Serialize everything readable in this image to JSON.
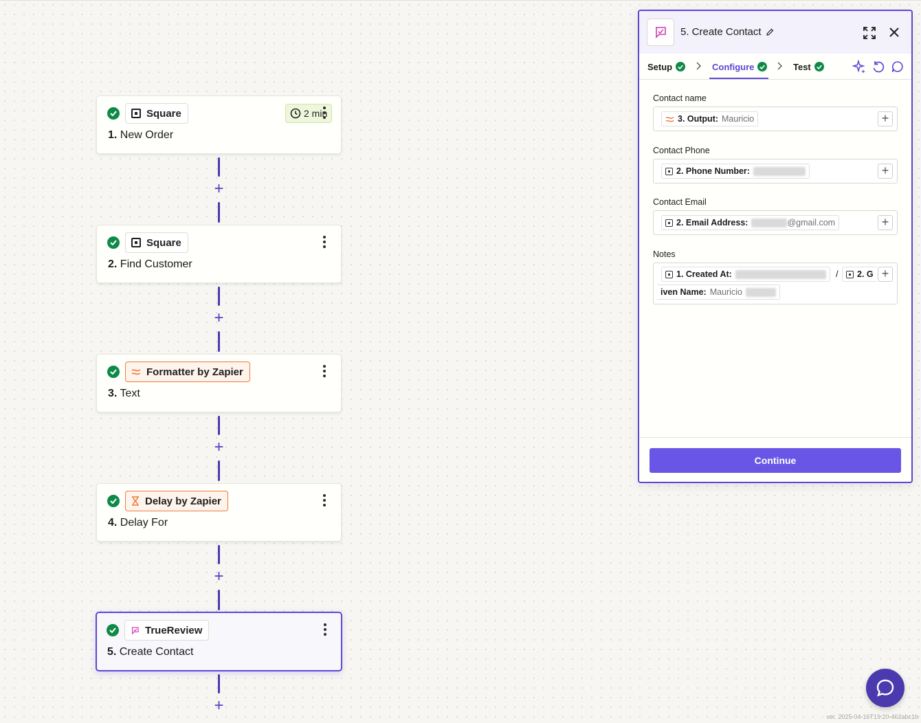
{
  "steps": [
    {
      "app": "Square",
      "number": "1.",
      "name": "New Order",
      "timer": "2 min"
    },
    {
      "app": "Square",
      "number": "2.",
      "name": "Find Customer"
    },
    {
      "app": "Formatter by Zapier",
      "number": "3.",
      "name": "Text"
    },
    {
      "app": "Delay by Zapier",
      "number": "4.",
      "name": "Delay For"
    },
    {
      "app": "TrueReview",
      "number": "5.",
      "name": "Create Contact"
    }
  ],
  "panel": {
    "title": "5. Create Contact",
    "tabs": [
      {
        "label": "Setup",
        "status": "complete"
      },
      {
        "label": "Configure",
        "status": "complete",
        "active": true
      },
      {
        "label": "Test",
        "status": "complete"
      }
    ],
    "fields": {
      "contact_name": {
        "label": "Contact name",
        "pill_label": "3. Output:",
        "pill_value": "Mauricio"
      },
      "contact_phone": {
        "label": "Contact Phone",
        "pill_label": "2. Phone Number:"
      },
      "contact_email": {
        "label": "Contact Email",
        "pill_label": "2. Email Address:",
        "pill_value": "@gmail.com"
      },
      "notes": {
        "label": "Notes",
        "pill1_label": "1. Created At:",
        "separator": "/",
        "pill2_label": "2. G",
        "pill2_cont_label": "iven Name:",
        "pill2_value": "Mauricio"
      }
    },
    "add_button": "+",
    "continue_label": "Continue"
  },
  "version": "ver. 2025-04-16T19:20-462abc1b",
  "colors": {
    "accent": "#5b47d6",
    "success": "#0e8a47",
    "formatter": "#f0793a",
    "continue": "#6a56e6"
  }
}
